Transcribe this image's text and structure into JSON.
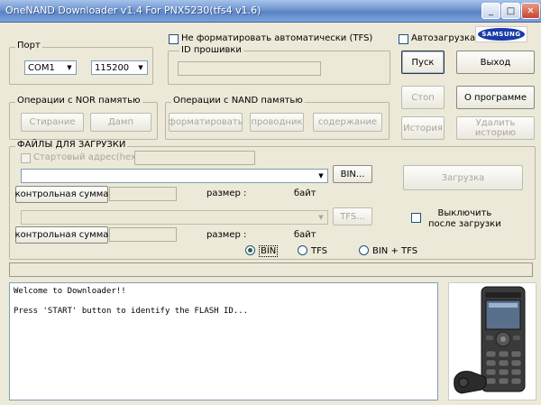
{
  "window": {
    "title": "OneNAND Downloader v1.4 For PNX5230(tfs4 v1.6)",
    "minimize": "_",
    "maximize": "□",
    "close": "✕"
  },
  "port": {
    "label": "Порт",
    "com_value": "COM1",
    "baud_value": "115200"
  },
  "firmware": {
    "no_format_label": "Не форматировать автоматически (TFS)",
    "id_label": "ID прошивки"
  },
  "autoload_label": "Автозагрузка",
  "brand": "SAMSUNG",
  "buttons": {
    "start": "Пуск",
    "exit": "Выход",
    "stop": "Стоп",
    "about": "О программе",
    "history": "История",
    "delete_history_line1": "Удалить",
    "delete_history_line2": "историю",
    "download": "Загрузка"
  },
  "nor": {
    "label": "Операции с  NOR памятью",
    "erase": "Стирание",
    "dump": "Дамп"
  },
  "nand": {
    "label": "Операции с NAND памятью",
    "format": "форматировать",
    "explorer": "проводник",
    "contents": "содержание"
  },
  "files": {
    "label": "ФАЙЛЫ ДЛЯ ЗАГРУЗКИ",
    "start_address_label": "Стартовый адрес(hex):",
    "bin_button": "BIN...",
    "tfs_button": "TFS...",
    "checksum_button": "контрольная сумма",
    "size_label": "размер :",
    "bytes_label": "байт",
    "shutdown_line1": "Выключить",
    "shutdown_line2": "после загрузки",
    "radio_bin": "BIN",
    "radio_tfs": "TFS",
    "radio_bin_tfs": "BIN + TFS"
  },
  "console": {
    "lines": [
      "Welcome to Downloader!!",
      "",
      "Press 'START' button to identify the FLASH ID..."
    ]
  },
  "colors": {
    "title_bar": "#6e95d0",
    "face": "#ece9d8",
    "border_blue": "#7f9db9"
  }
}
